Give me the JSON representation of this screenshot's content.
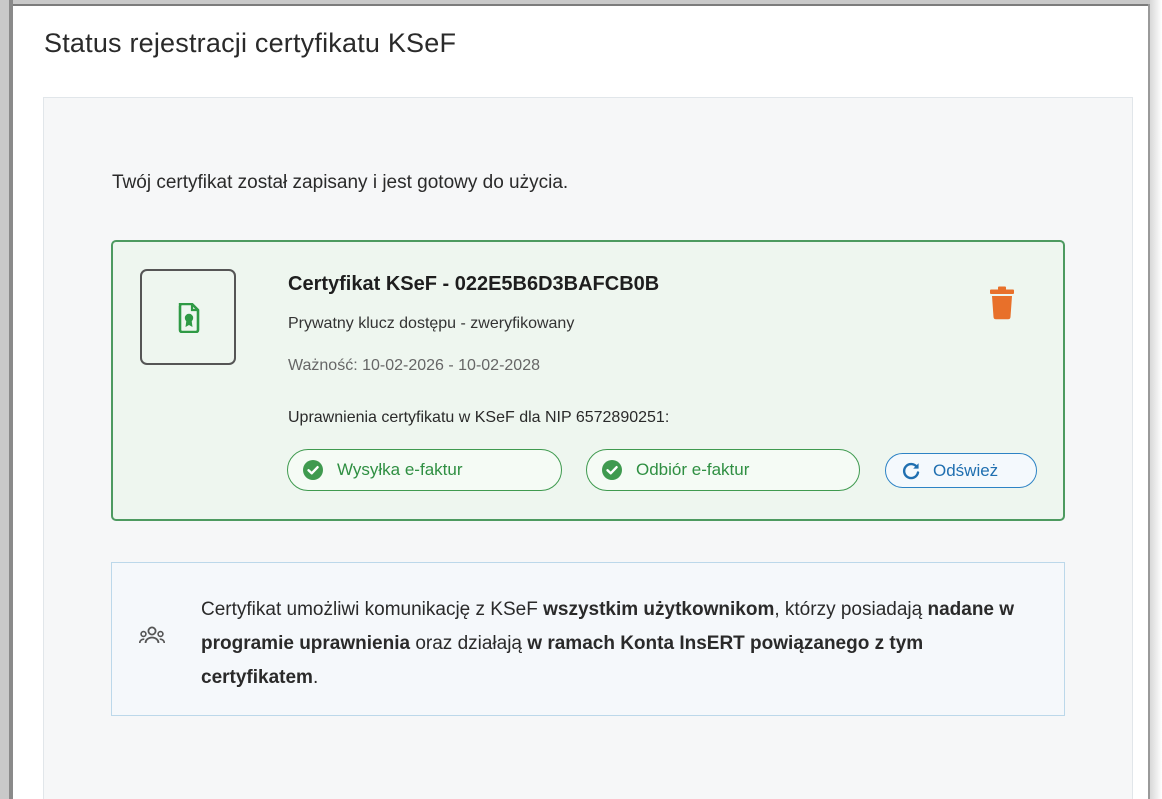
{
  "page": {
    "title": "Status rejestracji certyfikatu KSeF",
    "intro": "Twój certyfikat został zapisany i jest gotowy do użycia."
  },
  "certificate": {
    "title": "Certyfikat KSeF - 022E5B6D3BAFCB0B",
    "key_status": "Prywatny klucz dostępu - zweryfikowany",
    "validity": "Ważność: 10-02-2026 - 10-02-2028",
    "permissions_label": "Uprawnienia certyfikatu w KSeF dla NIP 6572890251:",
    "permissions": [
      {
        "label": "Wysyłka e-faktur",
        "icon": "check-circle-icon"
      },
      {
        "label": "Odbiór e-faktur",
        "icon": "check-circle-icon"
      }
    ],
    "refresh_label": "Odśwież",
    "delete_icon": "trash-icon",
    "file_icon": "certificate-file-icon"
  },
  "info": {
    "icon": "users-icon",
    "parts": [
      {
        "text": "Certyfikat umożliwi komunikację z KSeF ",
        "bold": false
      },
      {
        "text": "wszystkim użytkownikom",
        "bold": true
      },
      {
        "text": ", którzy posiadają ",
        "bold": false
      },
      {
        "text": "nadane w programie uprawnienia",
        "bold": true
      },
      {
        "text": " oraz działają ",
        "bold": false
      },
      {
        "text": "w ramach Konta InsERT powiązanego z tym certyfikatem",
        "bold": true
      },
      {
        "text": ".",
        "bold": false
      }
    ]
  },
  "colors": {
    "success": "#3f9a4f",
    "accent": "#2d83c5",
    "danger": "#e8702a",
    "card_border": "#4d9a60"
  }
}
